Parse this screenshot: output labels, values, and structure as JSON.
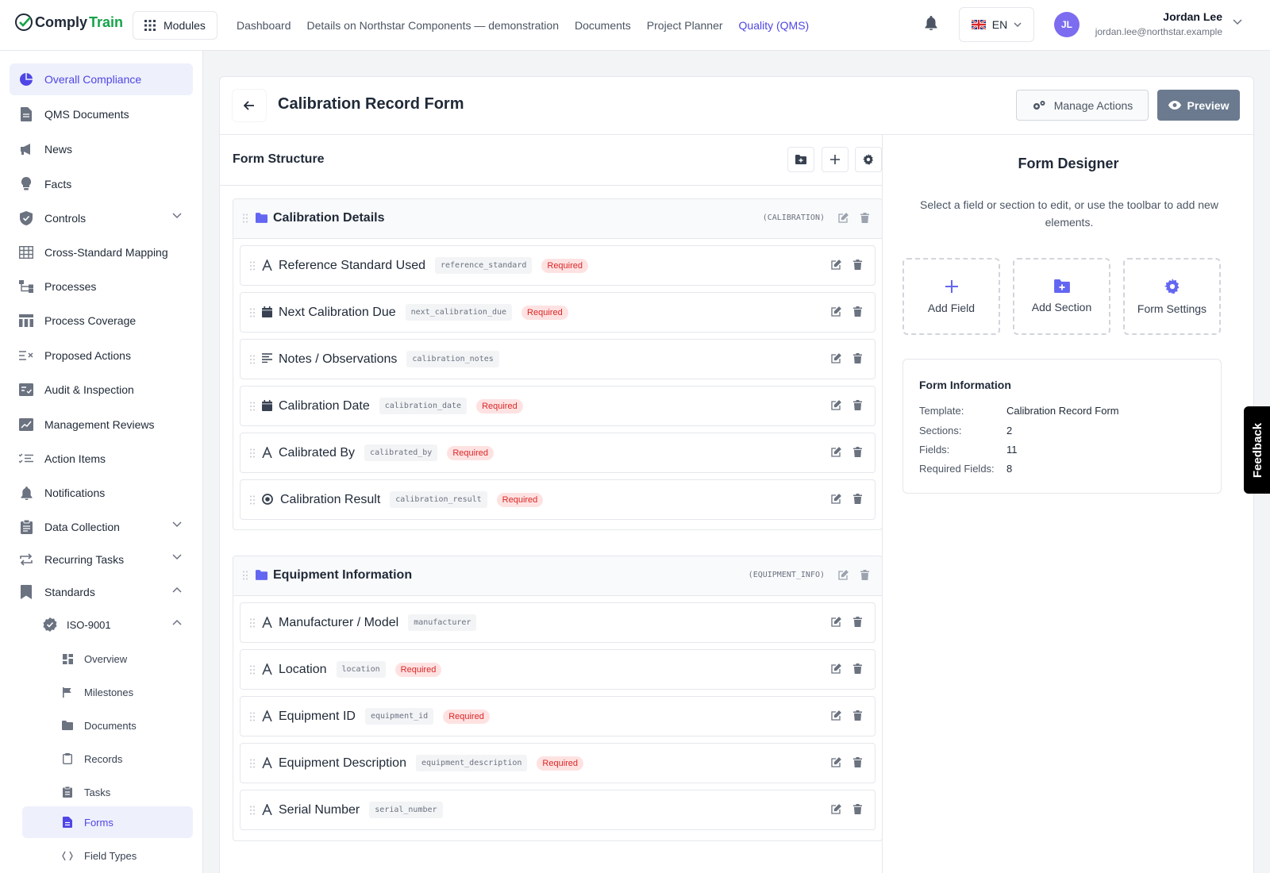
{
  "app": {
    "logo_part1": "Comply",
    "logo_part2": "Train",
    "modules_label": "Modules",
    "nav": [
      "Dashboard",
      "Details on Northstar Components — demonstration",
      "Documents",
      "Project Planner",
      "Quality (QMS)"
    ],
    "language": "EN",
    "user_initials": "JL",
    "user_name": "Jordan Lee",
    "user_email": "jordan.lee@northstar.example"
  },
  "sidebar": {
    "items": [
      "Overall Compliance",
      "QMS Documents",
      "News",
      "Facts",
      "Controls",
      "Cross-Standard Mapping",
      "Processes",
      "Process Coverage",
      "Proposed Actions",
      "Audit & Inspection",
      "Management Reviews",
      "Action Items",
      "Notifications",
      "Data Collection",
      "Recurring Tasks",
      "Standards"
    ],
    "standard": "ISO-9001",
    "sub_items": [
      "Overview",
      "Milestones",
      "Documents",
      "Records",
      "Tasks",
      "Forms",
      "Field Types"
    ]
  },
  "page": {
    "title": "Calibration Record Form",
    "manage_actions": "Manage Actions",
    "preview": "Preview"
  },
  "form_structure": {
    "title": "Form Structure",
    "required_label": "Required",
    "sections": [
      {
        "title": "Calibration Details",
        "key": "(CALIBRATION)",
        "fields": [
          {
            "label": "Reference Standard Used",
            "key": "reference_standard",
            "required": true,
            "icon": "text-icon"
          },
          {
            "label": "Next Calibration Due",
            "key": "next_calibration_due",
            "required": true,
            "icon": "calendar-icon"
          },
          {
            "label": "Notes / Observations",
            "key": "calibration_notes",
            "required": false,
            "icon": "textarea-icon"
          },
          {
            "label": "Calibration Date",
            "key": "calibration_date",
            "required": true,
            "icon": "calendar-icon"
          },
          {
            "label": "Calibrated By",
            "key": "calibrated_by",
            "required": true,
            "icon": "text-icon"
          },
          {
            "label": "Calibration Result",
            "key": "calibration_result",
            "required": true,
            "icon": "radio-icon"
          }
        ]
      },
      {
        "title": "Equipment Information",
        "key": "(EQUIPMENT_INFO)",
        "fields": [
          {
            "label": "Manufacturer / Model",
            "key": "manufacturer",
            "required": false,
            "icon": "text-icon"
          },
          {
            "label": "Location",
            "key": "location",
            "required": true,
            "icon": "text-icon"
          },
          {
            "label": "Equipment ID",
            "key": "equipment_id",
            "required": true,
            "icon": "text-icon"
          },
          {
            "label": "Equipment Description",
            "key": "equipment_description",
            "required": true,
            "icon": "text-icon"
          },
          {
            "label": "Serial Number",
            "key": "serial_number",
            "required": false,
            "icon": "text-icon"
          }
        ]
      }
    ]
  },
  "designer": {
    "title": "Form Designer",
    "hint": "Select a field or section to edit, or use the toolbar to add new elements.",
    "cards": [
      "Add Field",
      "Add Section",
      "Form Settings"
    ],
    "info_title": "Form Information",
    "info": [
      {
        "k": "Template:",
        "v": "Calibration Record Form"
      },
      {
        "k": "Sections:",
        "v": "2"
      },
      {
        "k": "Fields:",
        "v": "11"
      },
      {
        "k": "Required Fields:",
        "v": "8"
      }
    ]
  },
  "feedback": "Feedback",
  "colors": {
    "accent": "#4f46e5",
    "required": "#dc2626",
    "folder": "#6366f1"
  }
}
